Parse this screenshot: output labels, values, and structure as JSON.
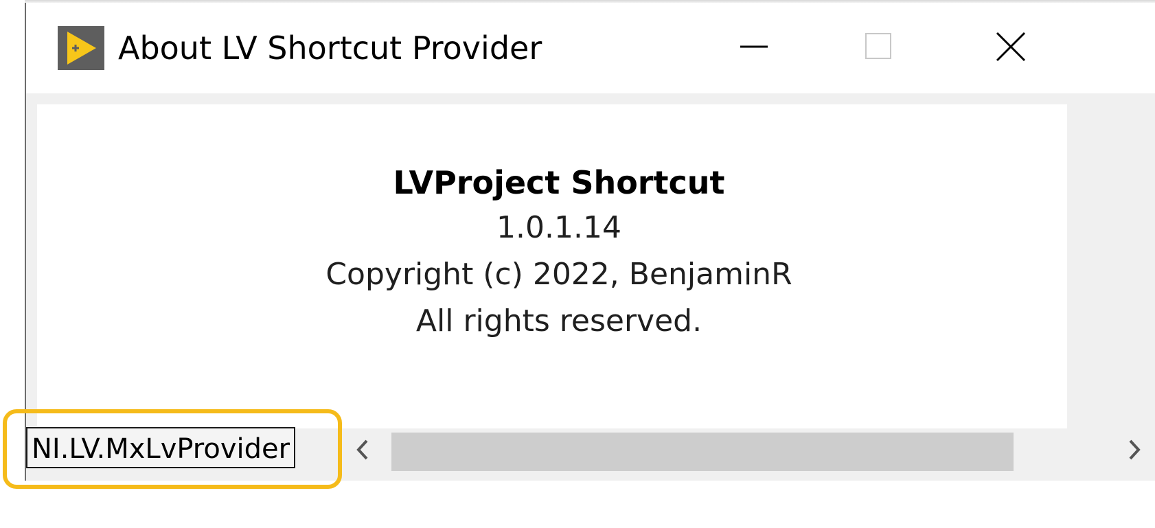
{
  "window": {
    "title": "About LV Shortcut Provider",
    "icon": "labview-icon",
    "controls": {
      "minimize_icon": "minimize-icon",
      "maximize_icon": "maximize-icon",
      "close_icon": "close-icon"
    }
  },
  "about": {
    "product_name": "LVProject Shortcut",
    "version": "1.0.1.14",
    "copyright": "Copyright (c) 2022, BenjaminR",
    "rights": "All rights reserved."
  },
  "tooltip": {
    "text": "NI.LV.MxLvProvider"
  },
  "scrollbar": {
    "left_icon": "chevron-left-icon",
    "right_icon": "chevron-right-icon"
  },
  "colors": {
    "highlight": "#f5bb1a",
    "icon_yellow": "#f7c61a",
    "icon_gray": "#5e5e5e"
  }
}
